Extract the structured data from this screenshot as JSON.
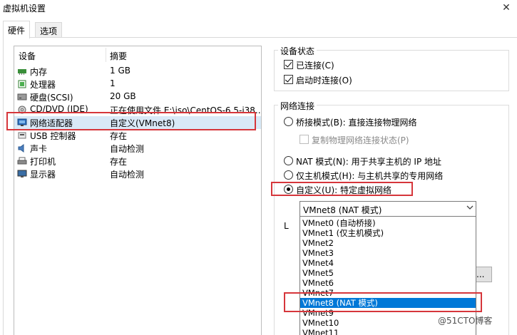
{
  "window": {
    "title": "虚拟机设置",
    "close_icon": "✕"
  },
  "tabs": [
    {
      "label": "硬件",
      "active": true
    },
    {
      "label": "选项",
      "active": false
    }
  ],
  "device_list": {
    "col_device": "设备",
    "col_summary": "摘要",
    "rows": [
      {
        "name": "内存",
        "summary": "1 GB",
        "icon": "memory-icon"
      },
      {
        "name": "处理器",
        "summary": "1",
        "icon": "cpu-icon"
      },
      {
        "name": "硬盘(SCSI)",
        "summary": "20 GB",
        "icon": "disk-icon"
      },
      {
        "name": "CD/DVD (IDE)",
        "summary": "正在使用文件 E:\\iso\\CentOS-6.5-i38...",
        "icon": "cd-icon"
      },
      {
        "name": "网络适配器",
        "summary": "自定义(VMnet8)",
        "icon": "network-icon",
        "selected": true
      },
      {
        "name": "USB 控制器",
        "summary": "存在",
        "icon": "usb-icon"
      },
      {
        "name": "声卡",
        "summary": "自动检测",
        "icon": "sound-icon"
      },
      {
        "name": "打印机",
        "summary": "存在",
        "icon": "printer-icon"
      },
      {
        "name": "显示器",
        "summary": "自动检测",
        "icon": "monitor-icon"
      }
    ]
  },
  "device_status": {
    "title": "设备状态",
    "connected": "已连接(C)",
    "connect_on_start": "启动时连接(O)"
  },
  "network": {
    "title": "网络连接",
    "bridged": "桥接模式(B): 直接连接物理网络",
    "replicate": "复制物理网络连接状态(P)",
    "nat": "NAT 模式(N): 用于共享主机的 IP 地址",
    "host_only": "仅主机模式(H): 与主机共享的专用网络",
    "custom": "自定义(U): 特定虚拟网络",
    "selected_vmnet": "VMnet8 (NAT 模式)",
    "lan_partial": "L",
    "button_partial": "...",
    "options": [
      "VMnet0 (自动桥接)",
      "VMnet1 (仅主机模式)",
      "VMnet2",
      "VMnet3",
      "VMnet4",
      "VMnet5",
      "VMnet6",
      "VMnet7",
      "VMnet8 (NAT 模式)",
      "VMnet9",
      "VMnet10",
      "VMnet11"
    ]
  },
  "watermark": "@51CTO博客",
  "colors": {
    "highlight": "#d6363b",
    "selection": "#0078d7",
    "row_selection": "#d9e9f7"
  }
}
